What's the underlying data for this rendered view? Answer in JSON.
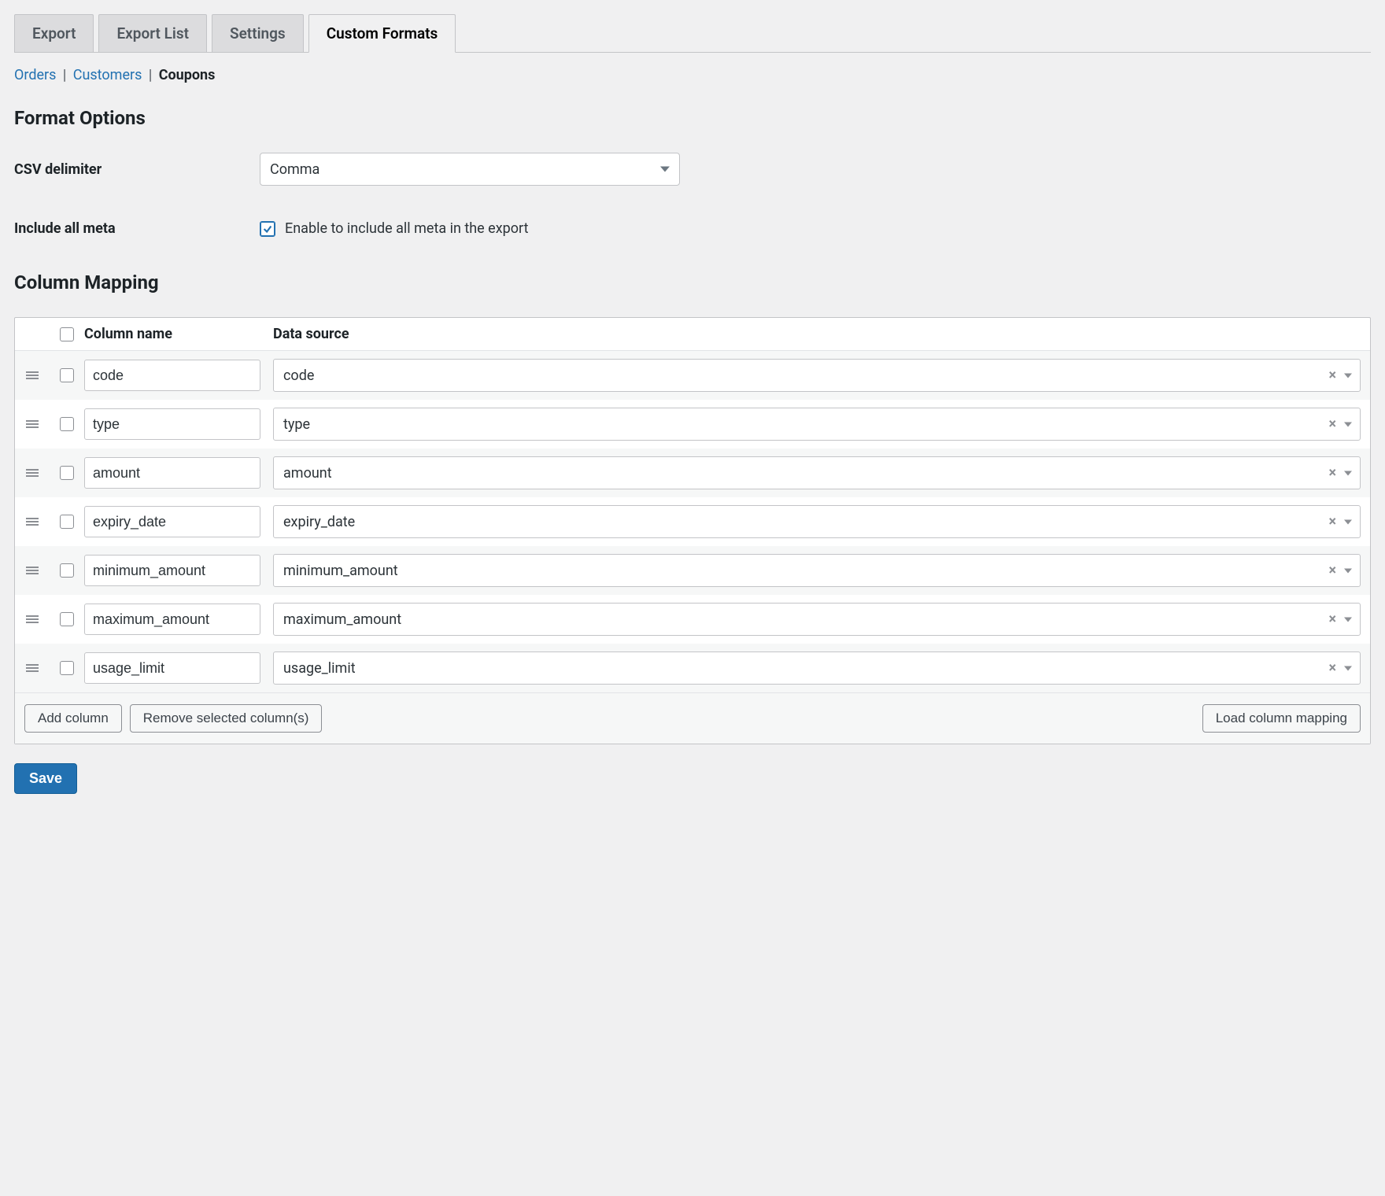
{
  "tabs": [
    {
      "label": "Export"
    },
    {
      "label": "Export List"
    },
    {
      "label": "Settings"
    },
    {
      "label": "Custom Formats"
    }
  ],
  "subnav": {
    "items": [
      {
        "label": "Orders"
      },
      {
        "label": "Customers"
      },
      {
        "label": "Coupons"
      }
    ]
  },
  "format_options": {
    "heading": "Format Options",
    "csv_delimiter_label": "CSV delimiter",
    "csv_delimiter_value": "Comma",
    "include_all_meta_label": "Include all meta",
    "include_all_meta_desc": "Enable to include all meta in the export"
  },
  "column_mapping": {
    "heading": "Column Mapping",
    "header_name": "Column name",
    "header_source": "Data source",
    "rows": [
      {
        "name": "code",
        "source": "code"
      },
      {
        "name": "type",
        "source": "type"
      },
      {
        "name": "amount",
        "source": "amount"
      },
      {
        "name": "expiry_date",
        "source": "expiry_date"
      },
      {
        "name": "minimum_amount",
        "source": "minimum_amount"
      },
      {
        "name": "maximum_amount",
        "source": "maximum_amount"
      },
      {
        "name": "usage_limit",
        "source": "usage_limit"
      }
    ],
    "footer": {
      "add": "Add column",
      "remove": "Remove selected column(s)",
      "load": "Load column mapping"
    }
  },
  "save_label": "Save"
}
